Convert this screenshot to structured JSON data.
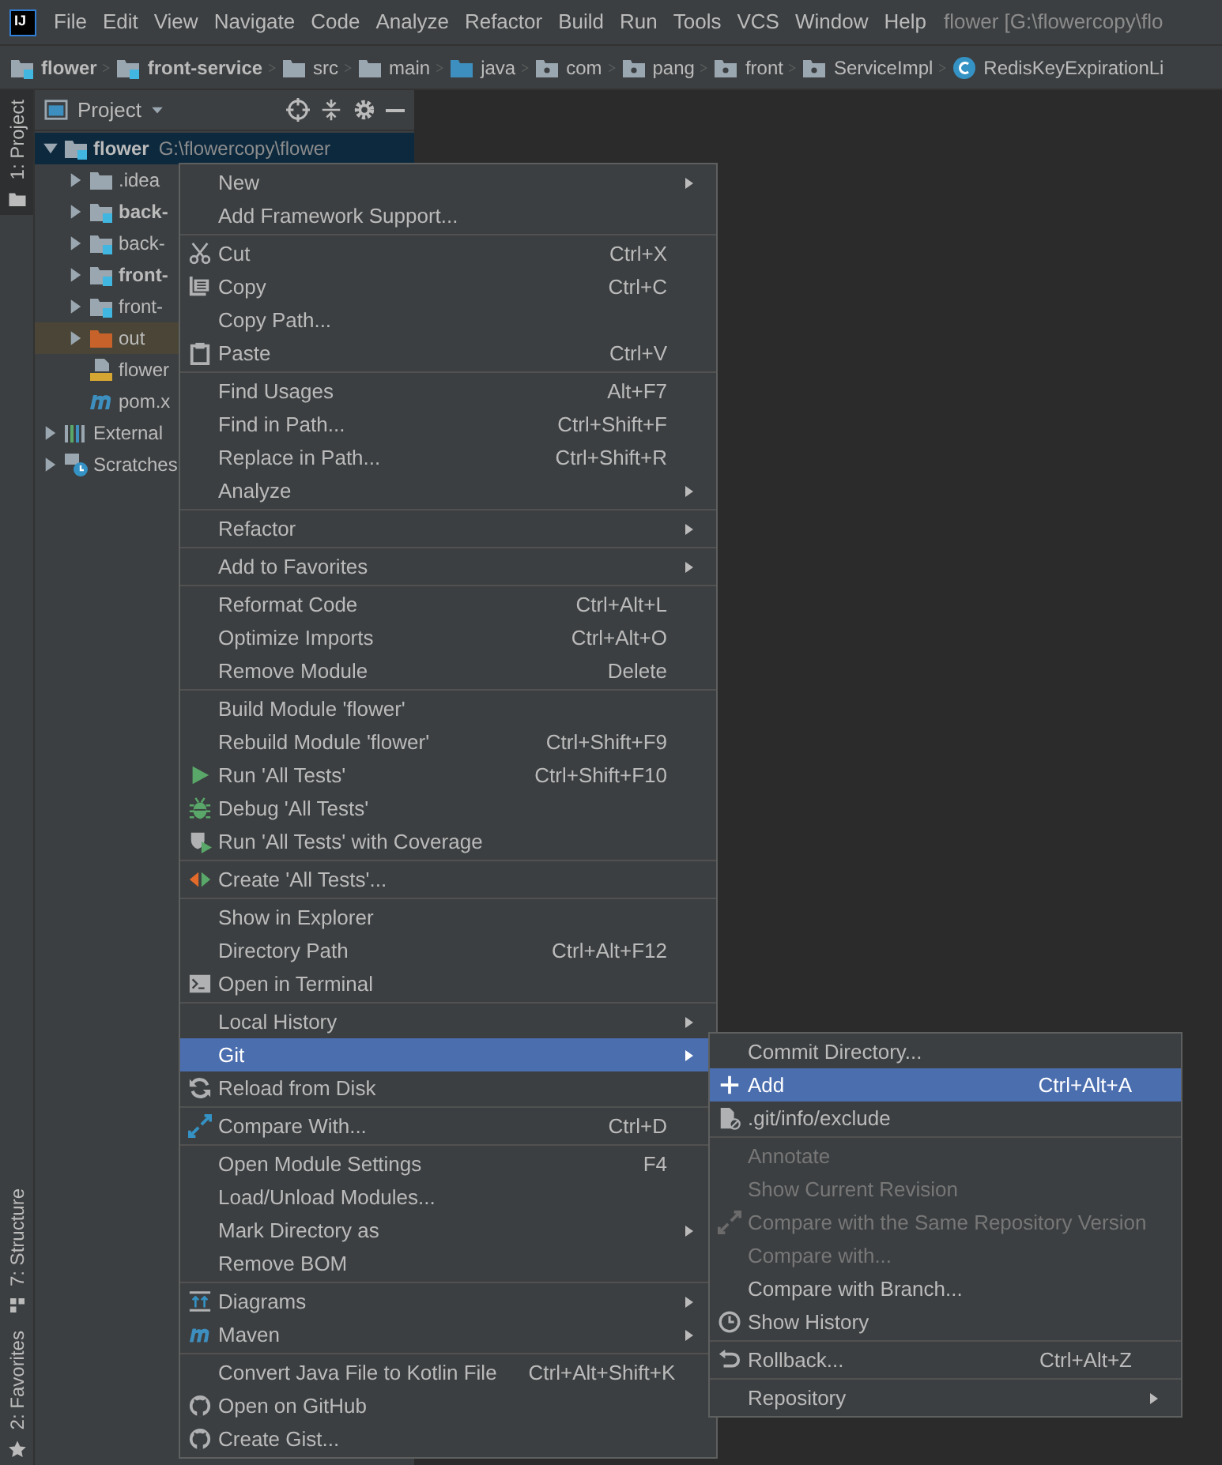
{
  "logo_text": "IJ",
  "menu_bar": [
    "File",
    "Edit",
    "View",
    "Navigate",
    "Code",
    "Analyze",
    "Refactor",
    "Build",
    "Run",
    "Tools",
    "VCS",
    "Window",
    "Help"
  ],
  "window_title": "flower [G:\\flowercopy\\flo",
  "breadcrumbs": [
    {
      "label": "flower",
      "kind": "module",
      "bold": true
    },
    {
      "label": "front-service",
      "kind": "module",
      "bold": true
    },
    {
      "label": "src",
      "kind": "folder",
      "bold": false
    },
    {
      "label": "main",
      "kind": "folder",
      "bold": false
    },
    {
      "label": "java",
      "kind": "source",
      "bold": false
    },
    {
      "label": "com",
      "kind": "package",
      "bold": false
    },
    {
      "label": "pang",
      "kind": "package",
      "bold": false
    },
    {
      "label": "front",
      "kind": "package",
      "bold": false
    },
    {
      "label": "ServiceImpl",
      "kind": "package",
      "bold": false
    },
    {
      "label": "RedisKeyExpirationLi",
      "kind": "class",
      "bold": false
    }
  ],
  "tool_tabs": [
    {
      "label": "1: Project",
      "selected": true
    },
    {
      "label": "7: Structure",
      "selected": false
    },
    {
      "label": "2: Favorites",
      "selected": false
    }
  ],
  "project_panel": {
    "title": "Project",
    "tree": [
      {
        "label": "flower",
        "path": "G:\\flowercopy\\flower",
        "kind": "module",
        "bold": true,
        "expanded": true,
        "selected": true,
        "children": [
          {
            "label": ".idea",
            "kind": "folder",
            "bold": false,
            "expanded": false,
            "selected": false
          },
          {
            "label": "back-",
            "kind": "module",
            "bold": true,
            "expanded": false,
            "selected": false
          },
          {
            "label": "back-",
            "kind": "module",
            "bold": false,
            "expanded": false,
            "selected": false
          },
          {
            "label": "front-",
            "kind": "module",
            "bold": true,
            "expanded": false,
            "selected": false
          },
          {
            "label": "front-",
            "kind": "module",
            "bold": false,
            "expanded": false,
            "selected": false
          },
          {
            "label": "out",
            "kind": "excluded",
            "bold": false,
            "expanded": false,
            "selected": false
          },
          {
            "label": "flower",
            "kind": "sql",
            "bold": false,
            "selected": false
          },
          {
            "label": "pom.x",
            "kind": "maven",
            "bold": false,
            "selected": false
          }
        ]
      },
      {
        "label": "External",
        "kind": "libraries",
        "bold": false,
        "expanded": false,
        "selected": false
      },
      {
        "label": "Scratches",
        "kind": "scratches",
        "bold": false,
        "expanded": false,
        "selected": false
      }
    ]
  },
  "context_menu": {
    "groups": [
      [
        {
          "label": "New",
          "submenu": true,
          "selected": false,
          "disabled": false
        },
        {
          "label": "Add Framework Support...",
          "submenu": false,
          "selected": false,
          "disabled": false
        }
      ],
      [
        {
          "label": "Cut",
          "shortcut": "Ctrl+X",
          "submenu": false,
          "selected": false,
          "disabled": false
        },
        {
          "label": "Copy",
          "shortcut": "Ctrl+C",
          "submenu": false,
          "selected": false,
          "disabled": false
        },
        {
          "label": "Copy Path...",
          "submenu": false,
          "selected": false,
          "disabled": false
        },
        {
          "label": "Paste",
          "shortcut": "Ctrl+V",
          "submenu": false,
          "selected": false,
          "disabled": false
        }
      ],
      [
        {
          "label": "Find Usages",
          "shortcut": "Alt+F7",
          "submenu": false,
          "selected": false,
          "disabled": false
        },
        {
          "label": "Find in Path...",
          "shortcut": "Ctrl+Shift+F",
          "submenu": false,
          "selected": false,
          "disabled": false
        },
        {
          "label": "Replace in Path...",
          "shortcut": "Ctrl+Shift+R",
          "submenu": false,
          "selected": false,
          "disabled": false
        },
        {
          "label": "Analyze",
          "submenu": true,
          "selected": false,
          "disabled": false
        }
      ],
      [
        {
          "label": "Refactor",
          "submenu": true,
          "selected": false,
          "disabled": false
        }
      ],
      [
        {
          "label": "Add to Favorites",
          "submenu": true,
          "selected": false,
          "disabled": false
        }
      ],
      [
        {
          "label": "Reformat Code",
          "shortcut": "Ctrl+Alt+L",
          "submenu": false,
          "selected": false,
          "disabled": false
        },
        {
          "label": "Optimize Imports",
          "shortcut": "Ctrl+Alt+O",
          "submenu": false,
          "selected": false,
          "disabled": false
        },
        {
          "label": "Remove Module",
          "shortcut": "Delete",
          "submenu": false,
          "selected": false,
          "disabled": false
        }
      ],
      [
        {
          "label": "Build Module 'flower'",
          "submenu": false,
          "selected": false,
          "disabled": false
        },
        {
          "label": "Rebuild Module 'flower'",
          "shortcut": "Ctrl+Shift+F9",
          "submenu": false,
          "selected": false,
          "disabled": false
        },
        {
          "label": "Run 'All Tests'",
          "shortcut": "Ctrl+Shift+F10",
          "submenu": false,
          "selected": false,
          "disabled": false
        },
        {
          "label": "Debug 'All Tests'",
          "submenu": false,
          "selected": false,
          "disabled": false
        },
        {
          "label": "Run 'All Tests' with Coverage",
          "submenu": false,
          "selected": false,
          "disabled": false
        }
      ],
      [
        {
          "label": "Create 'All Tests'...",
          "submenu": false,
          "selected": false,
          "disabled": false
        }
      ],
      [
        {
          "label": "Show in Explorer",
          "submenu": false,
          "selected": false,
          "disabled": false
        },
        {
          "label": "Directory Path",
          "shortcut": "Ctrl+Alt+F12",
          "submenu": false,
          "selected": false,
          "disabled": false
        },
        {
          "label": "Open in Terminal",
          "submenu": false,
          "selected": false,
          "disabled": false
        }
      ],
      [
        {
          "label": "Local History",
          "submenu": true,
          "selected": false,
          "disabled": false
        },
        {
          "label": "Git",
          "submenu": true,
          "selected": true,
          "disabled": false
        },
        {
          "label": "Reload from Disk",
          "submenu": false,
          "selected": false,
          "disabled": false
        }
      ],
      [
        {
          "label": "Compare With...",
          "shortcut": "Ctrl+D",
          "submenu": false,
          "selected": false,
          "disabled": false
        }
      ],
      [
        {
          "label": "Open Module Settings",
          "shortcut": "F4",
          "submenu": false,
          "selected": false,
          "disabled": false
        },
        {
          "label": "Load/Unload Modules...",
          "submenu": false,
          "selected": false,
          "disabled": false
        },
        {
          "label": "Mark Directory as",
          "submenu": true,
          "selected": false,
          "disabled": false
        },
        {
          "label": "Remove BOM",
          "submenu": false,
          "selected": false,
          "disabled": false
        }
      ],
      [
        {
          "label": "Diagrams",
          "submenu": true,
          "selected": false,
          "disabled": false
        },
        {
          "label": "Maven",
          "submenu": true,
          "selected": false,
          "disabled": false
        }
      ],
      [
        {
          "label": "Convert Java File to Kotlin File",
          "shortcut": "Ctrl+Alt+Shift+K",
          "submenu": false,
          "selected": false,
          "disabled": false
        },
        {
          "label": "Open on GitHub",
          "submenu": false,
          "selected": false,
          "disabled": false
        },
        {
          "label": "Create Gist...",
          "submenu": false,
          "selected": false,
          "disabled": false
        }
      ]
    ]
  },
  "git_submenu": {
    "groups": [
      [
        {
          "label": "Commit Directory...",
          "submenu": false,
          "selected": false,
          "disabled": false
        },
        {
          "label": "Add",
          "shortcut": "Ctrl+Alt+A",
          "submenu": false,
          "selected": true,
          "disabled": false
        },
        {
          "label": ".git/info/exclude",
          "submenu": false,
          "selected": false,
          "disabled": false
        }
      ],
      [
        {
          "label": "Annotate",
          "submenu": false,
          "selected": false,
          "disabled": true
        },
        {
          "label": "Show Current Revision",
          "submenu": false,
          "selected": false,
          "disabled": true
        },
        {
          "label": "Compare with the Same Repository Version",
          "submenu": false,
          "selected": false,
          "disabled": true
        },
        {
          "label": "Compare with...",
          "submenu": false,
          "selected": false,
          "disabled": true
        },
        {
          "label": "Compare with Branch...",
          "submenu": false,
          "selected": false,
          "disabled": false
        },
        {
          "label": "Show History",
          "submenu": false,
          "selected": false,
          "disabled": false
        }
      ],
      [
        {
          "label": "Rollback...",
          "shortcut": "Ctrl+Alt+Z",
          "submenu": false,
          "selected": false,
          "disabled": false
        }
      ],
      [
        {
          "label": "Repository",
          "submenu": true,
          "selected": false,
          "disabled": false
        }
      ]
    ]
  }
}
